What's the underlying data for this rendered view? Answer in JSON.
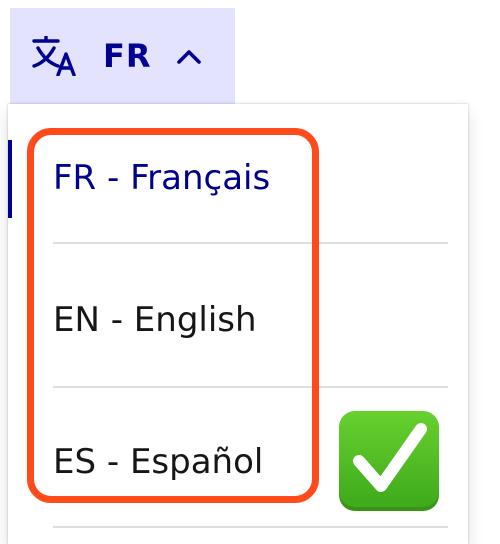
{
  "language_toggle": {
    "code": "FR",
    "icon": "translate-icon",
    "chevron": "chevron-up-icon",
    "expanded": true
  },
  "languages": [
    {
      "label": "FR - Français",
      "selected": true
    },
    {
      "label": "EN - English",
      "selected": false
    },
    {
      "label": "ES - Español",
      "selected": false
    }
  ],
  "annotation": {
    "highlight_color": "#ff4a1c",
    "check_icon": "check-mark-icon",
    "check_color": "#4cbb23"
  },
  "colors": {
    "accent": "#000091",
    "toggle_background": "#e3e3fd",
    "text": "#161616"
  }
}
